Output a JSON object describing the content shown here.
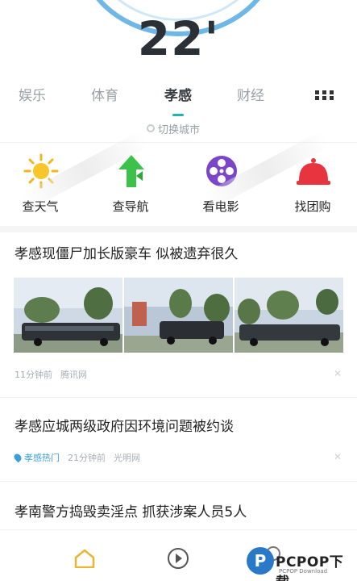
{
  "weather": {
    "temperature": "22'"
  },
  "tabs": [
    {
      "label": "娱乐"
    },
    {
      "label": "体育"
    },
    {
      "label": "孝感",
      "active": true
    },
    {
      "label": "财经"
    }
  ],
  "more_icon": "grid-icon",
  "switch_city": {
    "label": "切换城市"
  },
  "shortcuts": [
    {
      "label": "查天气",
      "icon": "sun-icon"
    },
    {
      "label": "查导航",
      "icon": "navigation-arrow-icon"
    },
    {
      "label": "看电影",
      "icon": "film-reel-icon"
    },
    {
      "label": "找团购",
      "icon": "food-cloche-icon"
    }
  ],
  "articles": [
    {
      "title": "孝感现僵尸加长版豪车 似被遗弃很久",
      "time": "11分钟前",
      "source": "腾讯网"
    },
    {
      "title": "孝感应城两级政府因环境问题被约谈",
      "tag": "孝感热门",
      "time": "21分钟前",
      "source": "光明网"
    },
    {
      "title": "孝南警方捣毁卖淫点 抓获涉案人员5人"
    }
  ],
  "watermark": {
    "badge": "P",
    "text": "PCPOP下载",
    "sub": "PCPOP Download"
  },
  "colors": {
    "accent": "#1fb6a3",
    "tag": "#3aa0d8",
    "home_icon": "#e8b632"
  }
}
